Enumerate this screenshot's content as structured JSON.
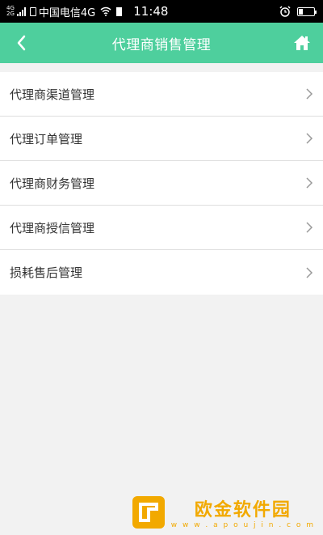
{
  "status_bar": {
    "network_badge_top": "4G",
    "network_badge_bottom": "2G",
    "carrier": "中国电信4G",
    "time": "11:48"
  },
  "header": {
    "title": "代理商销售管理",
    "back_icon": "chevron-left-icon",
    "home_icon": "home-icon",
    "background_color": "#4ecf9d"
  },
  "menu": {
    "items": [
      {
        "label": "代理商渠道管理"
      },
      {
        "label": "代理订单管理"
      },
      {
        "label": "代理商财务管理"
      },
      {
        "label": "代理商授信管理"
      },
      {
        "label": "损耗售后管理"
      }
    ]
  },
  "watermark": {
    "main_text": "欧金软件园",
    "sub_text": "w w w . a p o u j i n . c o m"
  }
}
